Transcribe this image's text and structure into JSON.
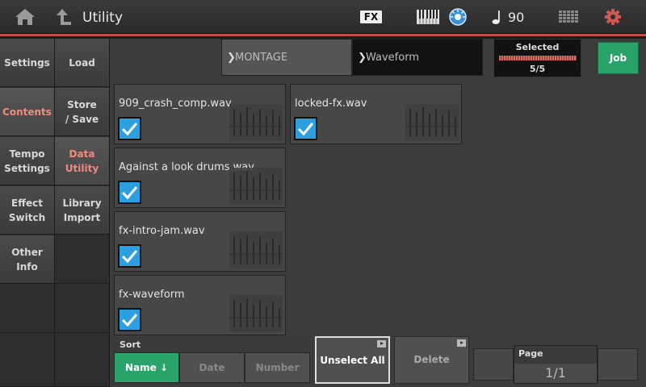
{
  "header": {
    "title": "Utility",
    "fx_label": "FX",
    "tempo": "90",
    "accent_color": "#b8524a"
  },
  "nav_left": [
    {
      "label": "Settings",
      "active": false
    },
    {
      "label": "Contents",
      "active": true
    },
    {
      "label": "Tempo\nSettings",
      "active": false
    },
    {
      "label": "Effect\nSwitch",
      "active": false
    },
    {
      "label": "Other\nInfo",
      "active": false
    }
  ],
  "nav_sub": [
    {
      "label": "Load",
      "active": false
    },
    {
      "label": "Store\n/ Save",
      "active": false
    },
    {
      "label": "Data\nUtility",
      "active": true
    },
    {
      "label": "Library\nImport",
      "active": false
    }
  ],
  "path": {
    "root": "MONTAGE",
    "current": "Waveform"
  },
  "selected": {
    "label": "Selected",
    "count": "5/5",
    "fraction": 1.0
  },
  "job_label": "Job",
  "files": [
    {
      "name": "909_crash_comp.wav",
      "checked": true
    },
    {
      "name": "locked-fx.wav",
      "checked": true
    },
    {
      "name": "Against a look drums.wav",
      "checked": true
    },
    {
      "name": "fx-intro-jam.wav",
      "checked": true
    },
    {
      "name": "fx-waveform",
      "checked": true
    }
  ],
  "sort": {
    "label": "Sort",
    "options": [
      "Name ↓",
      "Date",
      "Number"
    ],
    "active_index": 0
  },
  "buttons": {
    "unselect_all": "Unselect All",
    "delete": "Delete"
  },
  "page": {
    "label": "Page",
    "value": "1/1"
  },
  "colors": {
    "check_blue": "#2b9fe0",
    "active_green": "#2aa36a",
    "nav_active_text": "#f08a80"
  }
}
